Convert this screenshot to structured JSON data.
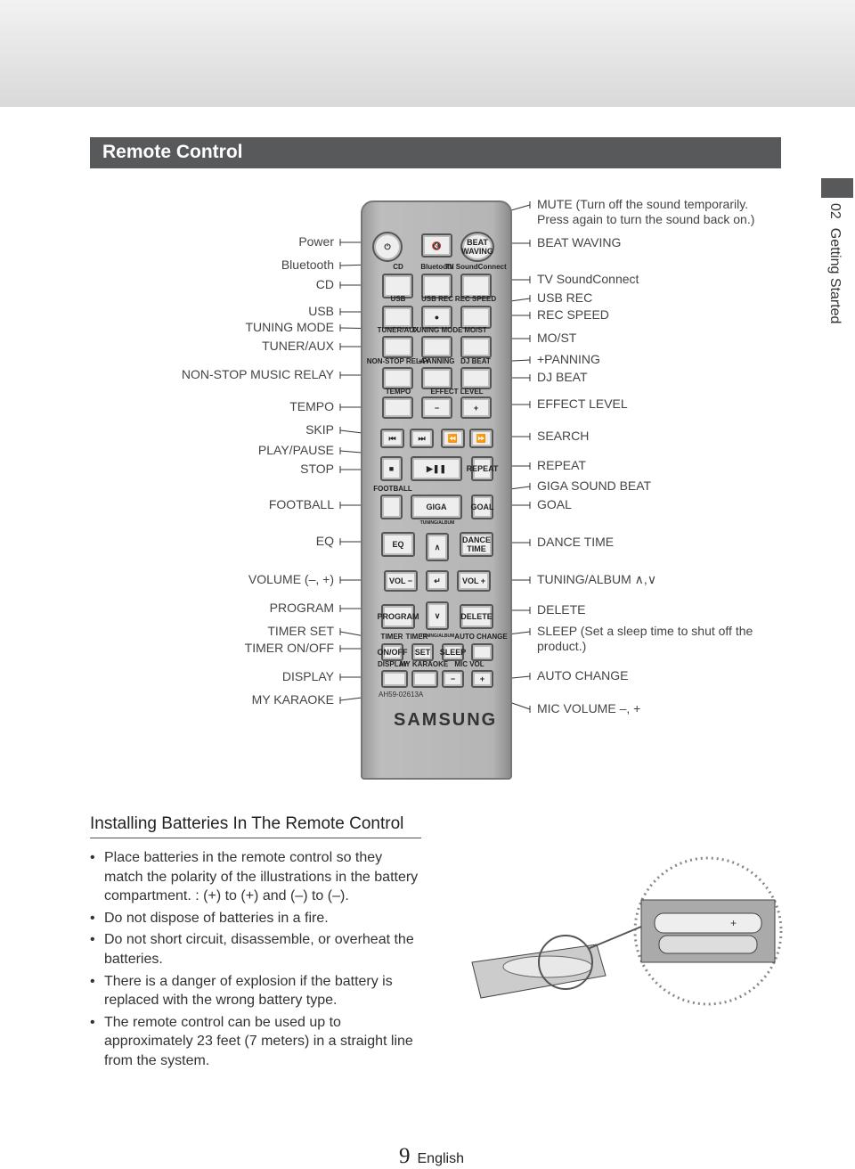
{
  "header": {
    "title": "Remote Control"
  },
  "side_tab": {
    "chapter": "02",
    "label": "Getting Started"
  },
  "remote": {
    "buttons": {
      "beat_waving": "BEAT WAVING",
      "vol_minus": "VOL −",
      "vol_plus": "VOL +",
      "eq": "EQ",
      "dance_time": "DANCE TIME",
      "program": "PROGRAM",
      "delete": "DELETE",
      "on_off": "ON/OFF",
      "set": "SET",
      "sleep": "SLEEP",
      "repeat": "REPEAT",
      "goal": "GOAL",
      "giga": "GIGA",
      "minus": "−",
      "plus": "+"
    },
    "captions": {
      "cd": "CD",
      "bluetooth": "Bluetooth",
      "tv": "TV SoundConnect",
      "usb": "USB",
      "usb_rec": "USB REC",
      "rec_speed": "REC SPEED",
      "tuner": "TUNER/AUX",
      "tuning": "TUNING MODE",
      "most": "MO/ST",
      "nonstop": "NON-STOP RELAY",
      "panning": "+PANNING",
      "djbeat": "DJ BEAT",
      "tempo": "TEMPO",
      "effect": "EFFECT LEVEL",
      "football": "FOOTBALL",
      "tuning_album": "TUNING/ALBUM",
      "timer1": "TIMER",
      "timer2": "TIMER",
      "tuning_album2": "TUNING/ALBUM",
      "auto_change": "AUTO CHANGE",
      "display": "DISPLAY",
      "karaoke": "MY KARAOKE",
      "micvol": "MIC VOL"
    },
    "model": "AH59-02613A",
    "brand": "SAMSUNG"
  },
  "left_labels": [
    "Power",
    "Bluetooth",
    "CD",
    "USB",
    "TUNING MODE",
    "TUNER/AUX",
    "NON-STOP MUSIC RELAY",
    "TEMPO",
    "SKIP",
    "PLAY/PAUSE",
    "STOP",
    "FOOTBALL",
    "EQ",
    "VOLUME (–, +)",
    "PROGRAM",
    "TIMER SET",
    "TIMER ON/OFF",
    "DISPLAY",
    "MY KARAOKE"
  ],
  "right_labels": [
    "MUTE (Turn off the sound temporarily. Press again to turn the sound back on.)",
    "BEAT WAVING",
    "TV SoundConnect",
    "USB REC",
    "REC SPEED",
    "MO/ST",
    "+PANNING",
    "DJ BEAT",
    "EFFECT LEVEL",
    "SEARCH",
    "REPEAT",
    "GIGA SOUND BEAT",
    "GOAL",
    "DANCE TIME",
    "TUNING/ALBUM ∧,∨",
    "DELETE",
    "SLEEP (Set a sleep time to shut off the product.)",
    "AUTO CHANGE",
    "MIC VOLUME –, +"
  ],
  "batteries": {
    "heading": "Installing Batteries In The Remote Control",
    "bullets": [
      "Place batteries in the remote control so they match the polarity of the illustrations in the battery compartment. : (+) to (+) and (–) to (–).",
      "Do not dispose of batteries in a fire.",
      "Do not short circuit, disassemble, or overheat the batteries.",
      "There is a danger of explosion if the battery is replaced with the wrong battery type.",
      "The remote control can be used up to approximately 23 feet (7 meters) in a straight line from the system."
    ]
  },
  "footer": {
    "page": "9",
    "language": "English"
  }
}
